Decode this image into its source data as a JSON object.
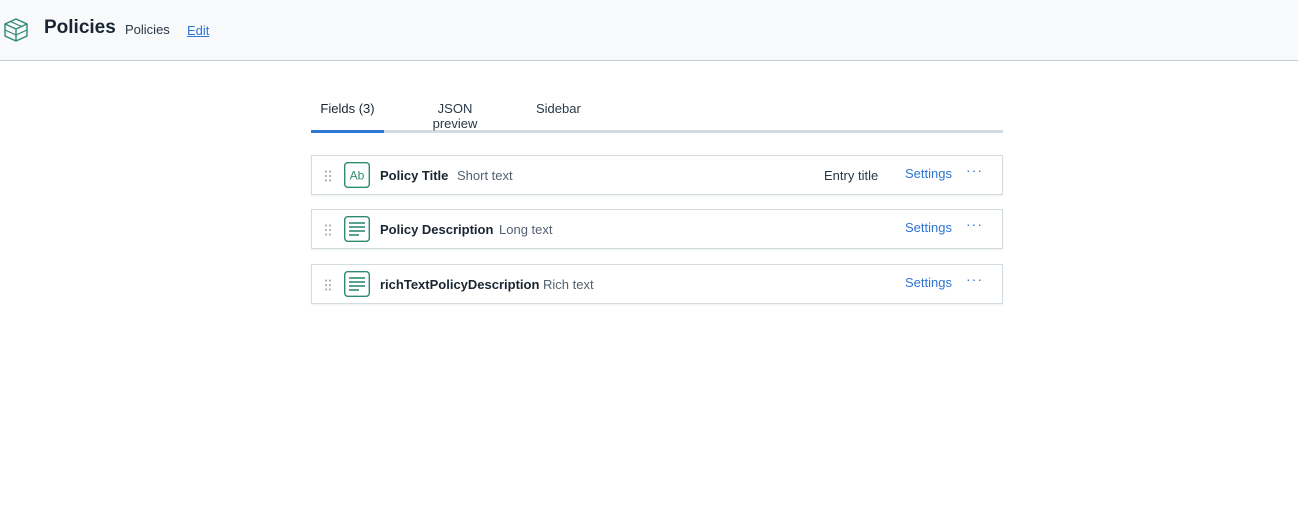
{
  "header": {
    "title": "Policies",
    "api_id": "Policies",
    "edit_label": "Edit",
    "logo_icon": "content-type-icon"
  },
  "tabs": [
    {
      "label": "Fields (3)",
      "active": true
    },
    {
      "label": "JSON preview",
      "active": false
    },
    {
      "label": "Sidebar",
      "active": false
    }
  ],
  "fields": [
    {
      "name": "Policy Title",
      "type": "Short text",
      "icon": "short-text-icon",
      "badge": "Entry title",
      "settings_label": "Settings",
      "more_label": "···"
    },
    {
      "name": "Policy Description",
      "type": "Long text",
      "icon": "long-text-icon",
      "settings_label": "Settings",
      "more_label": "···"
    },
    {
      "name": "richTextPolicyDescription",
      "type": "Rich text",
      "icon": "rich-text-icon",
      "settings_label": "Settings",
      "more_label": "···"
    }
  ],
  "colors": {
    "accent": "#2e75d4",
    "icon_green": "#2f8a72"
  }
}
